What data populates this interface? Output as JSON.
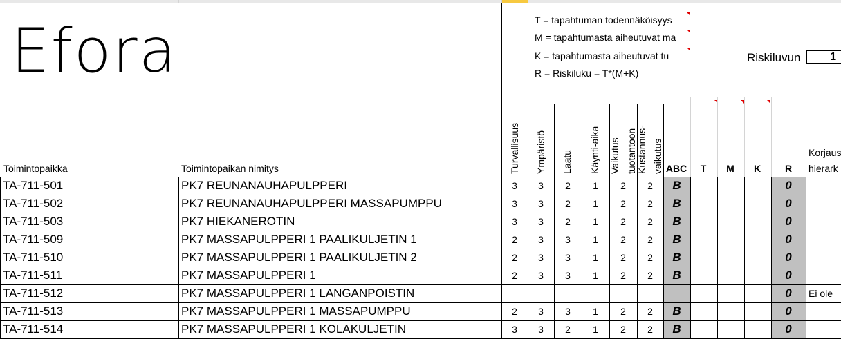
{
  "logo": {
    "text": "Efora"
  },
  "legend": {
    "t": "T  =   tapahtuman todennäköisyys",
    "m": "M =   tapahtumasta aiheutuvat ma",
    "k": "K  =  tapahtumasta aiheutuvat tu",
    "r": "R = Riskiluku = T*(M+K)"
  },
  "riskiluvun": {
    "label": "Riskiluvun",
    "value": "1"
  },
  "headers": {
    "toimintopaikka": "Toimintopaikka",
    "nimitys": "Toimintopaikan nimitys",
    "turvallisuus": "Turvallisuus",
    "ymparisto": "Ympäristö",
    "laatu": "Laatu",
    "kayntiaika": "Käynti-aika",
    "vaikutus_line1": "Vaikutus",
    "vaikutus_line2": "tuotantoon",
    "kustannus_line1": "Kustannus-",
    "kustannus_line2": "vaikutus",
    "abc": "ABC",
    "t": "T",
    "m": "M",
    "k": "K",
    "r": "R",
    "korjaus_line1": "Korjaus",
    "korjaus_line2": "hierark"
  },
  "rows": [
    {
      "id": "TA-711-501",
      "name": "PK7 REUNANAUHAPULPPERI",
      "v1": "3",
      "v2": "3",
      "v3": "2",
      "v4": "1",
      "v5": "2",
      "v6": "2",
      "abc": "B",
      "t": "",
      "m": "",
      "k": "",
      "r": "0",
      "note": ""
    },
    {
      "id": "TA-711-502",
      "name": "PK7 REUNANAUHAPULPPERI MASSAPUMPPU",
      "v1": "3",
      "v2": "3",
      "v3": "2",
      "v4": "1",
      "v5": "2",
      "v6": "2",
      "abc": "B",
      "t": "",
      "m": "",
      "k": "",
      "r": "0",
      "note": ""
    },
    {
      "id": "TA-711-503",
      "name": "PK7 HIEKANEROTIN",
      "v1": "3",
      "v2": "3",
      "v3": "2",
      "v4": "1",
      "v5": "2",
      "v6": "2",
      "abc": "B",
      "t": "",
      "m": "",
      "k": "",
      "r": "0",
      "note": ""
    },
    {
      "id": "TA-711-509",
      "name": "PK7 MASSAPULPPERI 1 PAALIKULJETIN 1",
      "v1": "2",
      "v2": "3",
      "v3": "3",
      "v4": "1",
      "v5": "2",
      "v6": "2",
      "abc": "B",
      "t": "",
      "m": "",
      "k": "",
      "r": "0",
      "note": ""
    },
    {
      "id": "TA-711-510",
      "name": "PK7 MASSAPULPPERI 1 PAALIKULJETIN 2",
      "v1": "2",
      "v2": "3",
      "v3": "3",
      "v4": "1",
      "v5": "2",
      "v6": "2",
      "abc": "B",
      "t": "",
      "m": "",
      "k": "",
      "r": "0",
      "note": ""
    },
    {
      "id": "TA-711-511",
      "name": "PK7 MASSAPULPPERI 1",
      "v1": "2",
      "v2": "3",
      "v3": "3",
      "v4": "1",
      "v5": "2",
      "v6": "2",
      "abc": "B",
      "t": "",
      "m": "",
      "k": "",
      "r": "0",
      "note": ""
    },
    {
      "id": "TA-711-512",
      "name": "PK7 MASSAPULPPERI 1 LANGANPOISTIN",
      "v1": "",
      "v2": "",
      "v3": "",
      "v4": "",
      "v5": "",
      "v6": "",
      "abc": "",
      "t": "",
      "m": "",
      "k": "",
      "r": "0",
      "note": "Ei ole"
    },
    {
      "id": "TA-711-513",
      "name": "PK7 MASSAPULPPERI 1 MASSAPUMPPU",
      "v1": "2",
      "v2": "3",
      "v3": "3",
      "v4": "1",
      "v5": "2",
      "v6": "2",
      "abc": "B",
      "t": "",
      "m": "",
      "k": "",
      "r": "0",
      "note": ""
    },
    {
      "id": "TA-711-514",
      "name": "PK7 MASSAPULPPERI 1 KOLAKULJETIN",
      "v1": "3",
      "v2": "3",
      "v3": "2",
      "v4": "1",
      "v5": "2",
      "v6": "2",
      "abc": "B",
      "t": "",
      "m": "",
      "k": "",
      "r": "0",
      "note": ""
    }
  ]
}
